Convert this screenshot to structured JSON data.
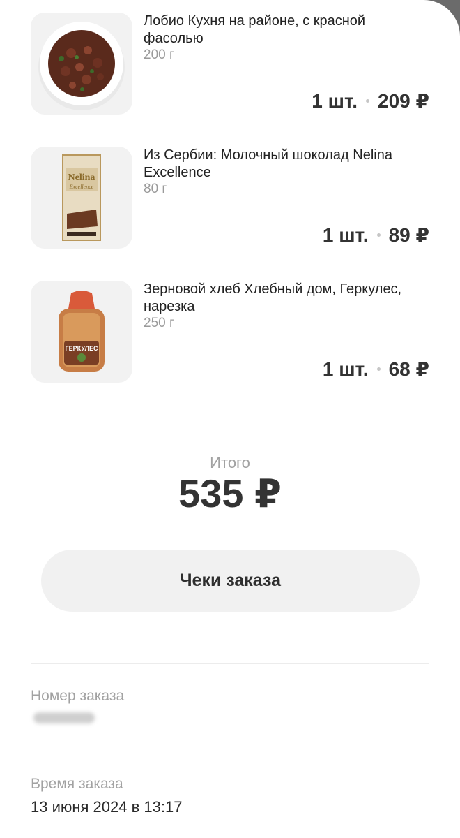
{
  "items": [
    {
      "name": "Лобио Кухня на районе, с красной фасолью",
      "weight": "200 г",
      "qty": "1 шт.",
      "price": "209 ₽",
      "icon": "bean-salad-bowl-image"
    },
    {
      "name": "Из Сербии: Молочный шоколад Nelina Excellence",
      "weight": "80 г",
      "qty": "1 шт.",
      "price": "89 ₽",
      "icon": "chocolate-bar-image",
      "package_text": "Nelina",
      "package_subtext": "Excellence"
    },
    {
      "name": "Зерновой хлеб Хлебный дом, Геркулес, нарезка",
      "weight": "250 г",
      "qty": "1 шт.",
      "price": "68 ₽",
      "icon": "bread-loaf-image",
      "package_text": "ГЕРКУЛЕС"
    }
  ],
  "total": {
    "label": "Итого",
    "value": "535 ₽"
  },
  "receipts_button": {
    "label": "Чеки заказа"
  },
  "order_number": {
    "label": "Номер заказа",
    "value_hidden": true
  },
  "order_time": {
    "label": "Время заказа",
    "value": "13 июня 2024 в 13:17"
  }
}
